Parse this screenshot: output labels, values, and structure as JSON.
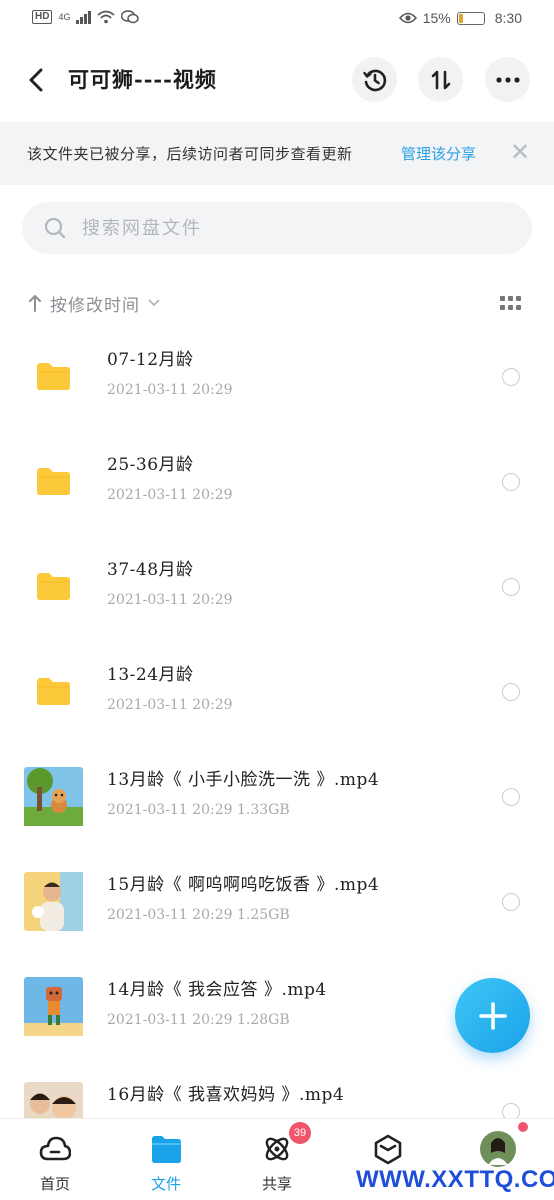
{
  "status_bar": {
    "network": "HD",
    "signal_type": "4G",
    "battery_percent": "15%",
    "time": "8:30",
    "battery_level": 0.15
  },
  "header": {
    "title": "可可狮----视频"
  },
  "share_banner": {
    "text": "该文件夹已被分享，后续访问者可同步查看更新",
    "action": "管理该分享",
    "close_icon": "close-icon"
  },
  "search": {
    "placeholder": "搜索网盘文件"
  },
  "sort": {
    "label": "按修改时间"
  },
  "files": [
    {
      "name": "07-12月龄",
      "meta": "2021-03-11 20:29",
      "kind": "folder"
    },
    {
      "name": "25-36月龄",
      "meta": "2021-03-11 20:29",
      "kind": "folder"
    },
    {
      "name": "37-48月龄",
      "meta": "2021-03-11 20:29",
      "kind": "folder"
    },
    {
      "name": "13-24月龄",
      "meta": "2021-03-11 20:29",
      "kind": "folder"
    },
    {
      "name": "13月龄《 小手小脸洗一洗 》.mp4",
      "meta": "2021-03-11 20:29   1.33GB",
      "kind": "video"
    },
    {
      "name": "15月龄《 啊呜啊呜吃饭香 》.mp4",
      "meta": "2021-03-11 20:29   1.25GB",
      "kind": "video"
    },
    {
      "name": "14月龄《 我会应答 》.mp4",
      "meta": "2021-03-11 20:29   1.28GB",
      "kind": "video"
    },
    {
      "name": "16月龄《 我喜欢妈妈 》.mp4",
      "meta": "",
      "kind": "video"
    }
  ],
  "bottom_nav": {
    "tabs": [
      {
        "label": "首页",
        "icon": "cloud-home-icon"
      },
      {
        "label": "文件",
        "icon": "folder-icon"
      },
      {
        "label": "共享",
        "icon": "atom-share-icon"
      },
      {
        "label": "",
        "icon": "cube-icon"
      },
      {
        "label": "",
        "icon": "avatar-icon"
      }
    ],
    "share_badge": "39"
  },
  "watermark": "WWW.XXTTQ.COM",
  "colors": {
    "accent": "#1aa2ea",
    "folder": "#fcc93a",
    "badge": "#f0556b"
  }
}
